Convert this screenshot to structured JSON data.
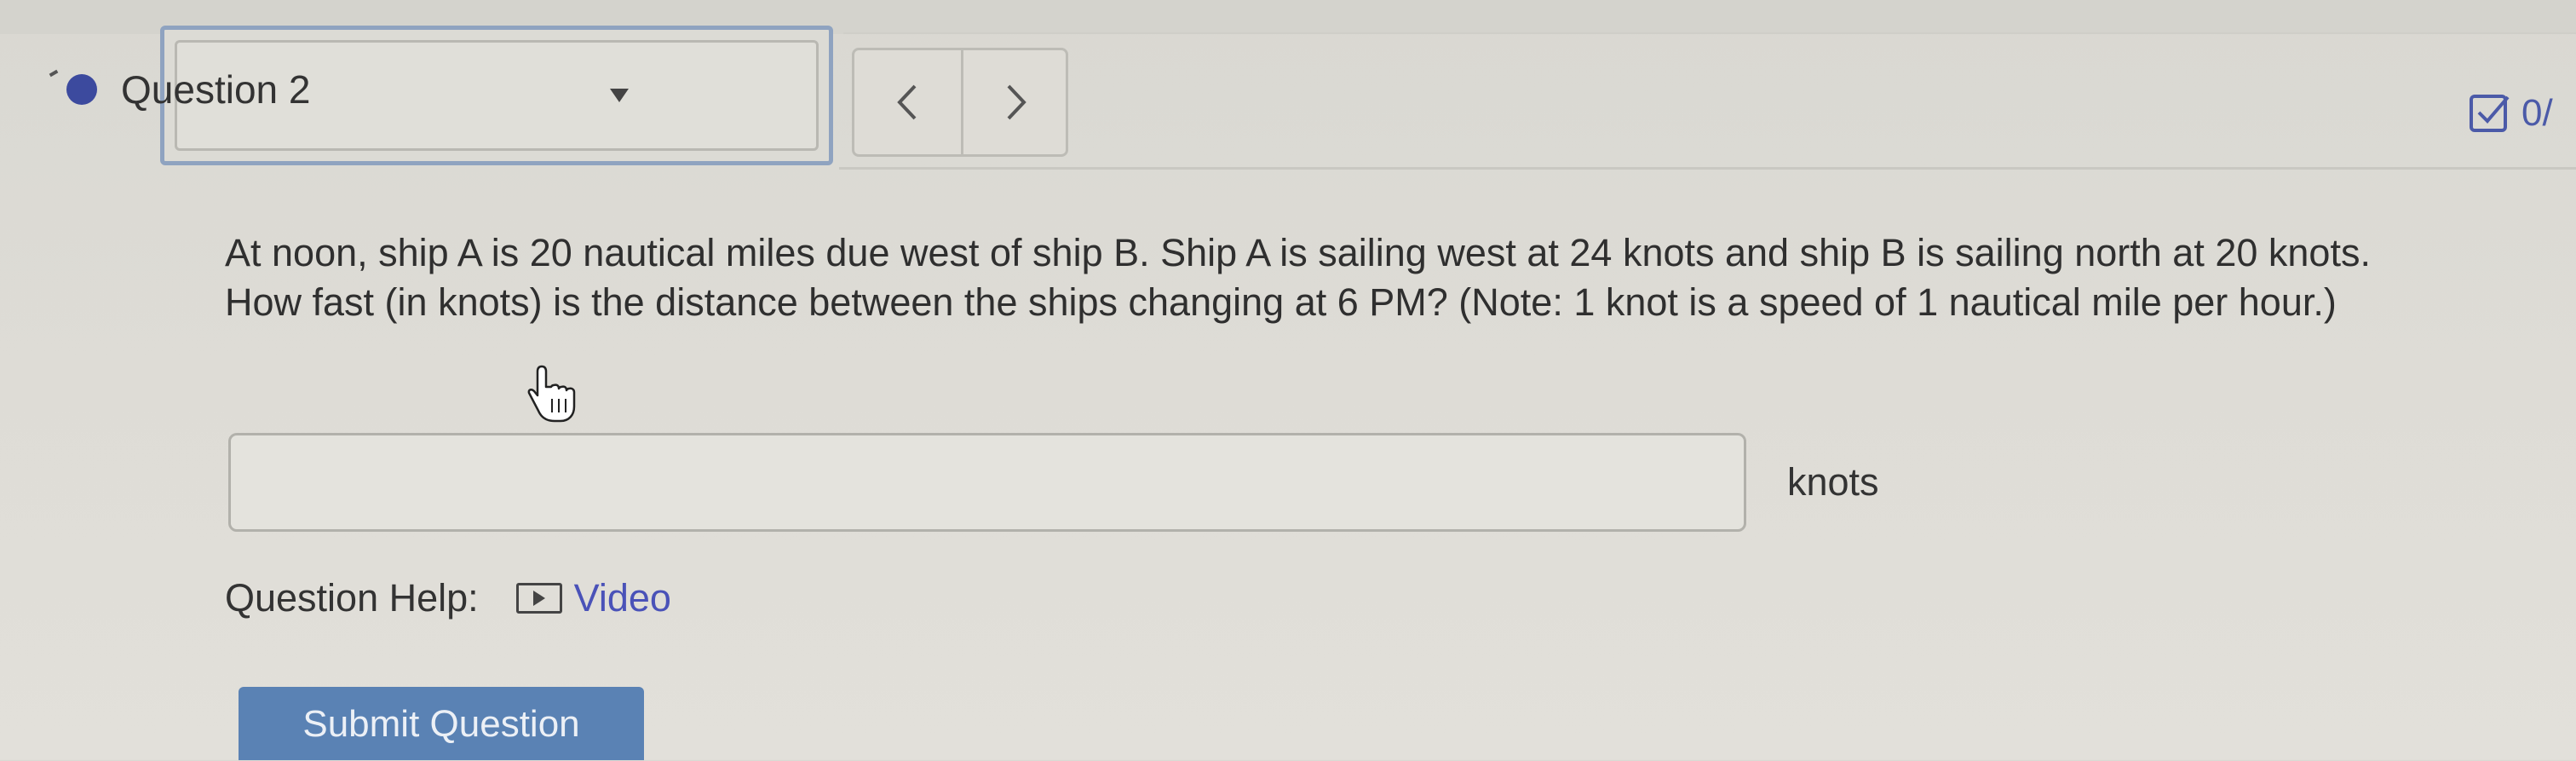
{
  "header": {
    "question_label": "Question 2",
    "score_text": "0/"
  },
  "question": {
    "text": "At noon, ship A is 20 nautical miles due west of ship B. Ship A is sailing west at 24 knots and ship B is sailing north at 20 knots. How fast (in knots) is the distance between the ships changing at 6 PM? (Note: 1 knot is a speed of 1 nautical mile per hour.)",
    "answer_value": "",
    "unit": "knots"
  },
  "help": {
    "label": "Question Help:",
    "video_label": "Video"
  },
  "actions": {
    "submit_label": "Submit Question"
  },
  "icons": {
    "status": "status-dot-icon",
    "dropdown": "caret-down-icon",
    "prev": "chevron-left-icon",
    "next": "chevron-right-icon",
    "score": "checkbox-icon",
    "video": "play-icon",
    "cursor": "hand-pointer-icon"
  },
  "colors": {
    "accent_blue": "#3c4a9e",
    "link_blue": "#4a52b8",
    "submit_bg": "#5a82b4",
    "selector_border": "#8fa3c0"
  }
}
